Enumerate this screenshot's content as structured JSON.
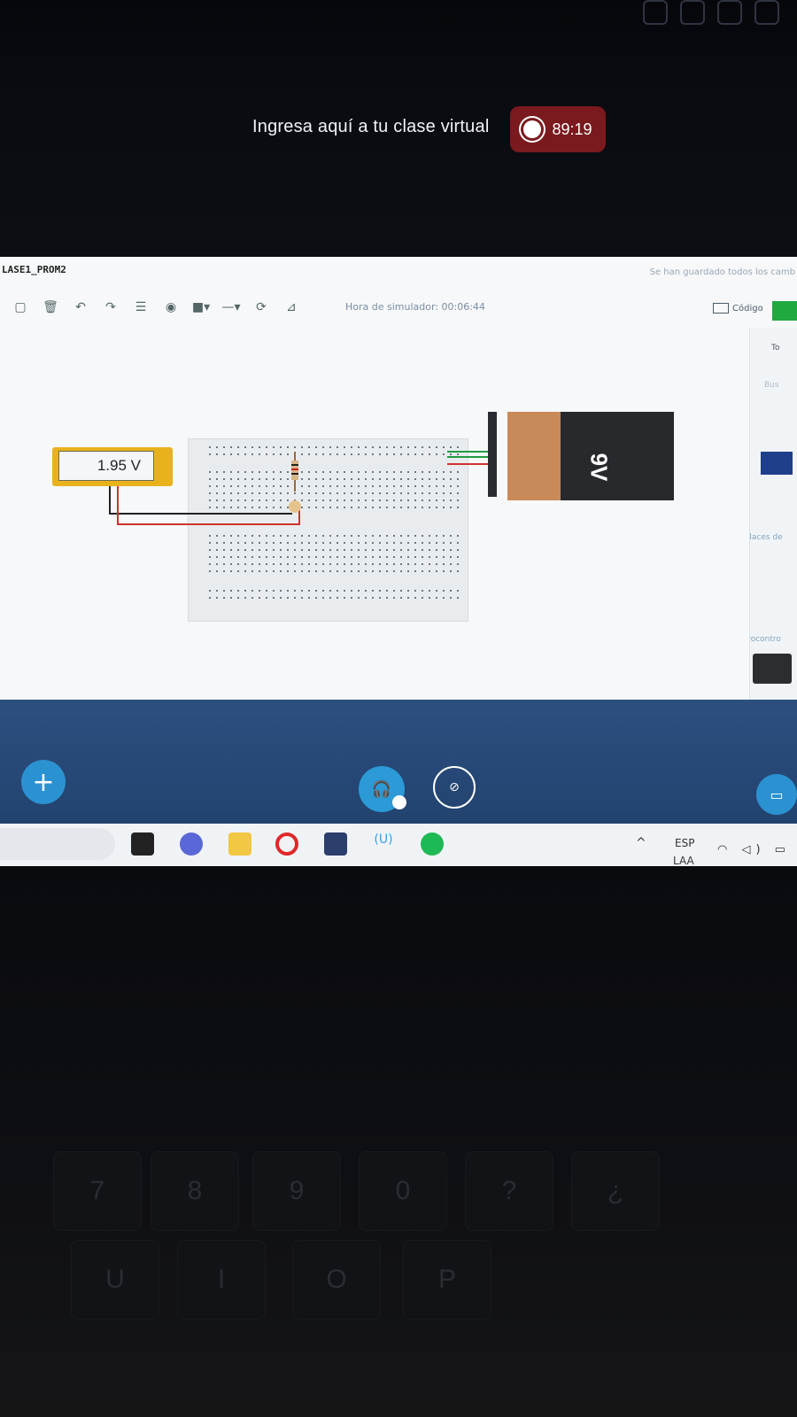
{
  "meeting": {
    "class_title": "Ingresa aquí a tu clase virtual",
    "timer": "89:19"
  },
  "app": {
    "file_title": "LASE1_PROM2",
    "saved_note": "Se han guardado todos los camb",
    "sim_time": "Hora de simulador: 00:06:44",
    "code_label": "Código",
    "right_panel": {
      "search_prefix": "Bus",
      "places_label": "Places de",
      "microcontrollers_label": "Microcontro",
      "top_text": "To"
    }
  },
  "circuit": {
    "multimeter_reading": "1.95 V",
    "battery_label": "9V"
  },
  "taskbar": {
    "lang_line1": "ESP",
    "lang_line2": "LAA"
  },
  "keyboard": {
    "keys_row1": [
      "7",
      "8",
      "9",
      "0",
      "?",
      "¿"
    ],
    "keys_row2": [
      "U",
      "I",
      "O",
      "P"
    ]
  },
  "colors": {
    "timer_bg": "#7a1a1e",
    "meeting_bar": "#2c4f80",
    "accent_blue": "#2b92d1",
    "multimeter": "#e8b21c",
    "start_green": "#20a93e"
  }
}
